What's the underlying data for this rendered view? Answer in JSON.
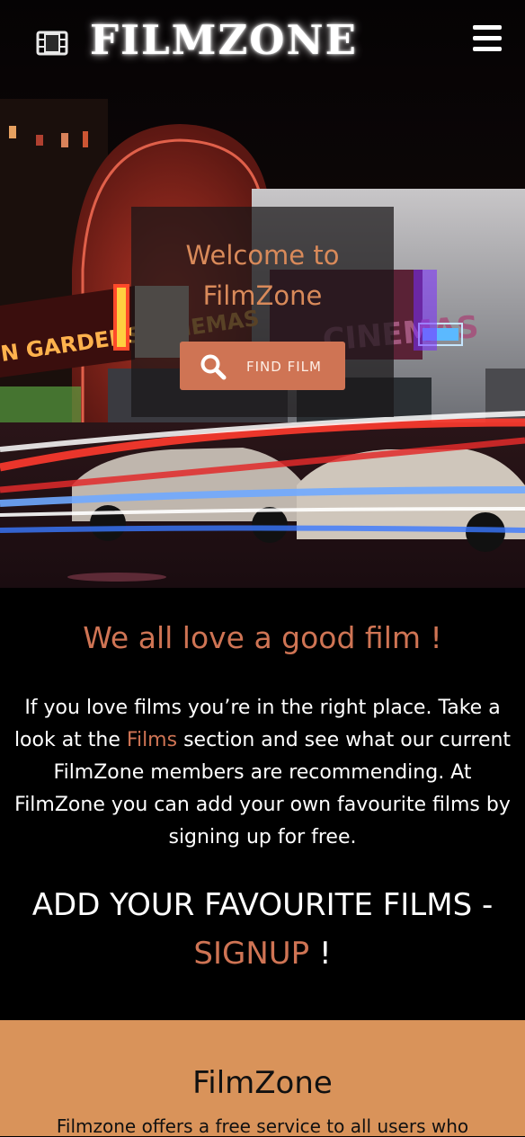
{
  "brand": {
    "name": "FILMZONE",
    "logo_icon": "film-strip-icon"
  },
  "nav": {
    "menu_icon": "hamburger-icon"
  },
  "hero": {
    "welcome_text": "Welcome to FilmZone",
    "find_button_label": "FIND FILM",
    "find_button_icon": "search-icon"
  },
  "intro": {
    "heading": "We all love a good film !",
    "text_before_link": "If you love films you’re in the right place. Take a look at the ",
    "films_link": "Films",
    "text_after_link": " section and see what our current FilmZone members are recommending. At FilmZone you can add your own favourite films by signing up for free.",
    "cta_text": "ADD YOUR FAVOURITE FILMS - ",
    "signup_link": "SIGNUP",
    "cta_end": " !"
  },
  "footer": {
    "title": "FilmZone",
    "text": "Filmzone offers a free service to all users who"
  },
  "colors": {
    "accent": "#cf7454",
    "footer_bg": "#d9935a",
    "background": "#000000"
  }
}
